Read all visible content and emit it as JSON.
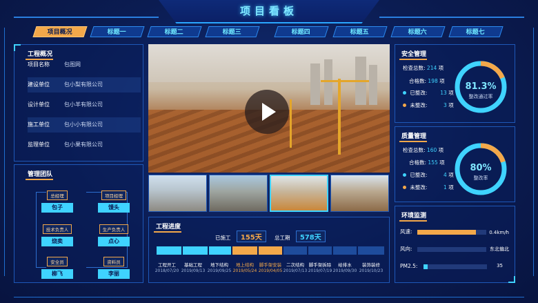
{
  "header": {
    "title": "项目看板"
  },
  "tabs": [
    "项目概况",
    "标题一",
    "标题二",
    "标题三",
    "标题四",
    "标题五",
    "标题六",
    "标题七"
  ],
  "project_overview": {
    "title": "工程概况",
    "rows": [
      {
        "label": "项目名称",
        "value": "包图网"
      },
      {
        "label": "建设单位",
        "value": "包小梨有限公司"
      },
      {
        "label": "设计单位",
        "value": "包小羊有限公司"
      },
      {
        "label": "施工单位",
        "value": "包小小有限公司"
      },
      {
        "label": "监理单位",
        "value": "包小果有限公司"
      }
    ]
  },
  "team": {
    "title": "管理团队",
    "members": [
      {
        "role": "总经理",
        "name": "包子"
      },
      {
        "role": "项目经理",
        "name": "馒头"
      },
      {
        "role": "技术负责人",
        "name": "烧卖"
      },
      {
        "role": "生产负责人",
        "name": "点心"
      },
      {
        "role": "安全员",
        "name": "柳飞"
      },
      {
        "role": "资料员",
        "name": "李丽"
      }
    ]
  },
  "progress": {
    "title": "工程进度",
    "used_label": "已施工",
    "used_value": "155天",
    "total_label": "总工期",
    "total_value": "578天",
    "stages": [
      {
        "name": "工程开工",
        "date": "2018/07/20",
        "status": "done"
      },
      {
        "name": "基础工程",
        "date": "2019/09/13",
        "status": "done"
      },
      {
        "name": "地下结构",
        "date": "2019/09/25",
        "status": "done"
      },
      {
        "name": "地上结构",
        "date": "2019/05/24",
        "status": "current"
      },
      {
        "name": "脚手架安装",
        "date": "2019/04/05",
        "status": "current"
      },
      {
        "name": "二次结构",
        "date": "2019/07/13",
        "status": "pending"
      },
      {
        "name": "脚手架拆除",
        "date": "2019/07/19",
        "status": "pending"
      },
      {
        "name": "给排水",
        "date": "2019/09/30",
        "status": "pending"
      },
      {
        "name": "装饰装修",
        "date": "2019/10/23",
        "status": "pending"
      }
    ]
  },
  "safety": {
    "title": "安全管理",
    "rows": [
      {
        "label": "检查总数:",
        "value": "214",
        "unit": "项",
        "dot": ""
      },
      {
        "label": "合格数:",
        "value": "198",
        "unit": "项",
        "dot": ""
      },
      {
        "label": "已整改:",
        "value": "13",
        "unit": "项",
        "dot": "#3fd3ff"
      },
      {
        "label": "未整改:",
        "value": "3",
        "unit": "项",
        "dot": "#f3a84a"
      }
    ],
    "ring_value": "81.3%",
    "ring_label": "整改通过率",
    "ring_fraction": 0.813
  },
  "quality": {
    "title": "质量管理",
    "rows": [
      {
        "label": "检查总数:",
        "value": "160",
        "unit": "项",
        "dot": ""
      },
      {
        "label": "合格数:",
        "value": "155",
        "unit": "项",
        "dot": ""
      },
      {
        "label": "已整改:",
        "value": "4",
        "unit": "项",
        "dot": "#3fd3ff"
      },
      {
        "label": "未整改:",
        "value": "1",
        "unit": "项",
        "dot": "#f3a84a"
      }
    ],
    "ring_value": "80%",
    "ring_label": "整改率",
    "ring_fraction": 0.8
  },
  "environment": {
    "title": "环境监测",
    "rows": [
      {
        "label": "风速:",
        "value": "0.4km/h",
        "fraction": 0.85,
        "color": "#f3a84a"
      },
      {
        "label": "风向:",
        "value": "东北偏北",
        "fraction": 0.0,
        "color": "#3fd3ff"
      },
      {
        "label": "PM2.5:",
        "value": "35",
        "fraction": 0.06,
        "color": "#3fd3ff"
      }
    ]
  },
  "colors": {
    "accent": "#3fd3ff",
    "highlight": "#f3a84a",
    "bg": "#0a1a4a"
  }
}
